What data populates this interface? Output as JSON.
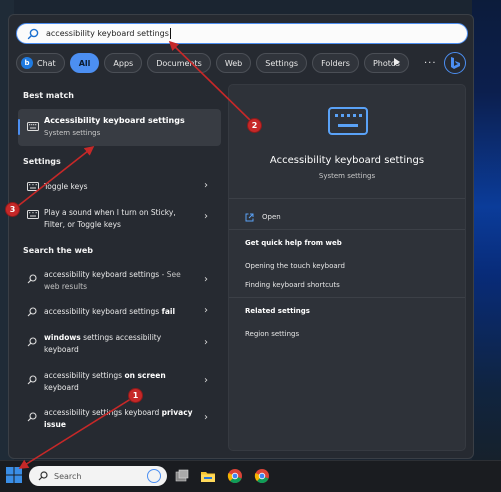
{
  "search": {
    "query": "accessibility keyboard settings"
  },
  "filters": [
    {
      "label": "Chat"
    },
    {
      "label": "All"
    },
    {
      "label": "Apps"
    },
    {
      "label": "Documents"
    },
    {
      "label": "Web"
    },
    {
      "label": "Settings"
    },
    {
      "label": "Folders"
    },
    {
      "label": "Photos"
    }
  ],
  "more_label": "...",
  "left": {
    "best_match_header": "Best match",
    "best_match": {
      "title": "Accessibility keyboard settings",
      "subtitle": "System settings"
    },
    "settings_header": "Settings",
    "settings_items": [
      {
        "label": "Toggle keys"
      },
      {
        "label": "Play a sound when I turn on Sticky, Filter, or Toggle keys"
      }
    ],
    "web_header": "Search the web",
    "web_items": [
      {
        "normal": "accessibility keyboard settings",
        "sub": " - See web results",
        "bold": ""
      },
      {
        "normal": "accessibility keyboard settings ",
        "bold": "fail",
        "sub": ""
      },
      {
        "normal": "",
        "bold_first": "windows",
        "rest": " settings accessibility keyboard"
      },
      {
        "normal": "accessibility settings ",
        "bold": "on screen",
        "tail": " keyboard"
      },
      {
        "normal": "accessibility settings keyboard ",
        "bold": "privacy issue"
      }
    ]
  },
  "preview": {
    "title": "Accessibility keyboard settings",
    "subtitle": "System settings",
    "open_label": "Open",
    "help_header": "Get quick help from web",
    "help_links": [
      "Opening the touch keyboard",
      "Finding keyboard shortcuts"
    ],
    "related_header": "Related settings",
    "related_links": [
      "Region settings"
    ]
  },
  "taskbar": {
    "search_label": "Search"
  },
  "annotations": [
    "1",
    "2",
    "3"
  ],
  "colors": {
    "accent": "#4c8ff2",
    "annotation": "#c62828",
    "panel": "#262a31"
  }
}
